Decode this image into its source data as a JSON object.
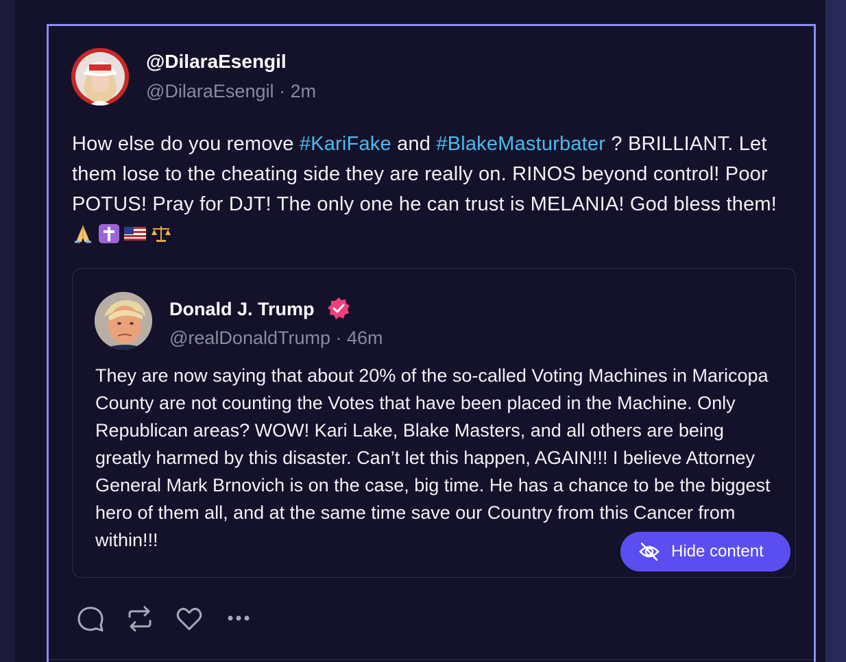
{
  "post": {
    "display_name": "@DilaraEsengil",
    "handle": "@DilaraEsengil",
    "separator": " · ",
    "time": "2m",
    "text_before_tag1": "How else do you remove ",
    "hashtag1": "#KariFake",
    "text_between": " and ",
    "hashtag2": "#BlakeMasturbater",
    "text_after": " ? BRILLIANT. Let them lose to the cheating side they are really on. RINOS beyond control! Poor POTUS! Pray for DJT! The only one he can trust is MELANIA! God bless them! ",
    "emojis": [
      "folded-hands-emoji",
      "latin-cross-emoji",
      "us-flag-emoji",
      "balance-scale-emoji"
    ]
  },
  "quote": {
    "display_name": "Donald J. Trump",
    "handle": "@realDonaldTrump",
    "separator": " · ",
    "time": "46m",
    "text": "They are now saying that about 20% of the so-called Voting Machines in Maricopa County are not counting the Votes that have been placed in the Machine. Only Republican areas? WOW! Kari Lake, Blake Masters, and all others are being greatly harmed by this disaster. Can’t let this happen, AGAIN!!! I believe Attorney General Mark Brnovich is on the case, big time. He has a chance to be the biggest hero of them all, and at the same time save our Country from this Cancer from within!!!",
    "hide_button_label": "Hide content"
  },
  "actions": [
    "reply-icon",
    "repost-icon",
    "like-icon",
    "more-icon"
  ],
  "colors": {
    "background": "#14122a",
    "accent_border": "#8a8cf5",
    "hashtag": "#4fb9ee",
    "button": "#5b4ef0",
    "verified": "#f0407a"
  }
}
